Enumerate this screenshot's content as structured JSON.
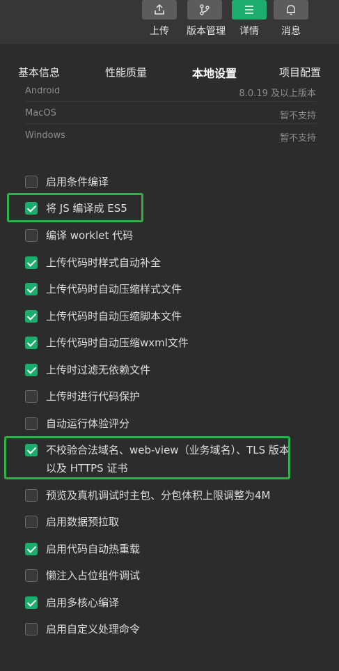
{
  "toolbar": {
    "buttons": [
      {
        "label": "上传",
        "icon": "upload-icon"
      },
      {
        "label": "版本管理",
        "icon": "branch-icon"
      },
      {
        "label": "详情",
        "icon": "menu-icon",
        "active": true
      },
      {
        "label": "消息",
        "icon": "bell-icon"
      }
    ]
  },
  "tabs": [
    {
      "label": "基本信息"
    },
    {
      "label": "性能质量"
    },
    {
      "label": "本地设置",
      "active": true
    },
    {
      "label": "项目配置"
    }
  ],
  "platform_support": [
    {
      "name": "Android",
      "value": "8.0.19 及以上版本"
    },
    {
      "name": "MacOS",
      "value": "暂不支持"
    },
    {
      "name": "Windows",
      "value": "暂不支持"
    }
  ],
  "options": [
    {
      "label": "启用条件编译",
      "checked": false
    },
    {
      "label": "将 JS 编译成 ES5",
      "checked": true
    },
    {
      "label": "编译 worklet 代码",
      "checked": false
    },
    {
      "label": "上传代码时样式自动补全",
      "checked": true
    },
    {
      "label": "上传代码时自动压缩样式文件",
      "checked": true
    },
    {
      "label": "上传代码时自动压缩脚本文件",
      "checked": true
    },
    {
      "label": "上传代码时自动压缩wxml文件",
      "checked": true
    },
    {
      "label": "上传时过滤无依赖文件",
      "checked": true
    },
    {
      "label": "上传时进行代码保护",
      "checked": false
    },
    {
      "label": "自动运行体验评分",
      "checked": false
    },
    {
      "label": "不校验合法域名、web-view（业务域名）、TLS 版本以及 HTTPS 证书",
      "checked": true
    },
    {
      "label": "预览及真机调试时主包、分包体积上限调整为4M",
      "checked": false
    },
    {
      "label": "启用数据预拉取",
      "checked": false
    },
    {
      "label": "启用代码自动热重载",
      "checked": true
    },
    {
      "label": "懒注入占位组件调试",
      "checked": false
    },
    {
      "label": "启用多核心编译",
      "checked": true
    },
    {
      "label": "启用自定义处理命令",
      "checked": false
    }
  ],
  "colors": {
    "background": "#2c2c2c",
    "toolbar": "#363636",
    "accent": "#1aad6b",
    "highlight": "#2fb146"
  }
}
